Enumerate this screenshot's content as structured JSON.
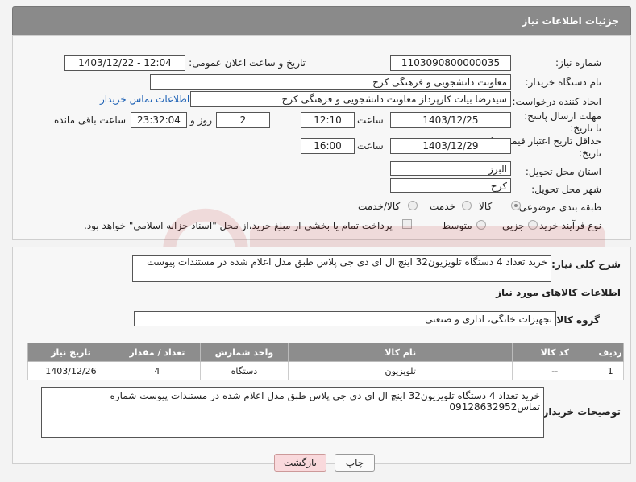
{
  "header": {
    "title": "جزئیات اطلاعات نیاز"
  },
  "fields": {
    "need_number_label": "شماره نیاز:",
    "need_number": "1103090800000035",
    "announce_label": "تاریخ و ساعت اعلان عمومی:",
    "announce_value": "1403/12/22 - 12:04",
    "buyer_org_label": "نام دستگاه خریدار:",
    "buyer_org": "معاونت دانشجویی و فرهنگی کرج",
    "creator_label": "ایجاد کننده درخواست:",
    "creator": "سیدرضا بیات کارپرداز معاونت دانشجویی و فرهنگی کرج",
    "contact_link": "اطلاعات تماس خریدار",
    "deadline_label": "مهلت ارسال پاسخ: تا تاریخ:",
    "deadline_date": "1403/12/25",
    "time_label": "ساعت",
    "deadline_time": "12:10",
    "days_value": "2",
    "days_label": "روز و",
    "remaining_time": "23:32:04",
    "remaining_label": "ساعت باقی مانده",
    "validity_label": "حداقل تاریخ اعتبار قیمت: تا تاریخ:",
    "validity_date": "1403/12/29",
    "validity_time": "16:00",
    "province_label": "استان محل تحویل:",
    "province": "البرز",
    "city_label": "شهر محل تحویل:",
    "city": "کرج",
    "category_label": "طبقه بندی موضوعی:",
    "cat_goods": "کالا",
    "cat_service": "خدمت",
    "cat_both": "کالا/خدمت",
    "process_label": "نوع فرآیند خرید :",
    "proc_partial": "جزیی",
    "proc_medium": "متوسط",
    "payment_note": "پرداخت تمام یا بخشی از مبلغ خرید،از محل \"اسناد خزانه اسلامی\" خواهد بود."
  },
  "description": {
    "label": "شرح کلی نیاز:",
    "text": "خرید تعداد 4 دستگاه تلویزیون32 اینچ ال ای دی جی پلاس طبق مدل اعلام شده در مستندات پیوست"
  },
  "goods": {
    "section_title": "اطلاعات کالاهای مورد نیاز",
    "group_label": "گروه کالا:",
    "group_value": "تجهیزات خانگی، اداری و صنعتی",
    "columns": [
      "ردیف",
      "کد کالا",
      "نام کالا",
      "واحد شمارش",
      "تعداد / مقدار",
      "تاریخ نیاز"
    ],
    "rows": [
      {
        "row": "1",
        "code": "--",
        "name": "تلویزیون",
        "unit": "دستگاه",
        "qty": "4",
        "date": "1403/12/26"
      }
    ]
  },
  "buyer_notes": {
    "label": "توضیحات خریدار:",
    "line1": "خرید تعداد 4 دستگاه تلویزیون32 اینچ ال ای دی جی پلاس طبق مدل اعلام شده در مستندات پیوست شماره",
    "line2": "تماس09128632952"
  },
  "buttons": {
    "print": "چاپ",
    "back": "بازگشت"
  },
  "colors": {
    "header_bg": "#8a8a8a",
    "link": "#1a5fb4",
    "back_bg": "#f9d9dc"
  }
}
